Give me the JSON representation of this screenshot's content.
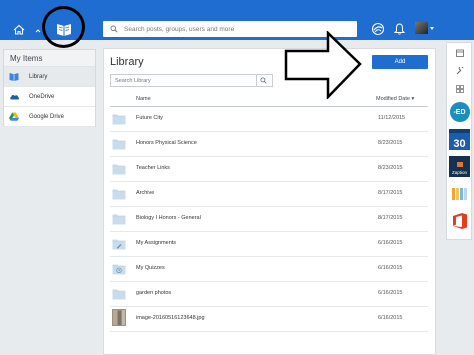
{
  "topbar": {
    "search_placeholder": "Search posts, groups, users and more"
  },
  "sidebar": {
    "title": "My Items",
    "items": [
      {
        "label": "Library",
        "icon": "library-icon"
      },
      {
        "label": "OneDrive",
        "icon": "onedrive-icon"
      },
      {
        "label": "Google Drive",
        "icon": "google-drive-icon"
      }
    ]
  },
  "main": {
    "title": "Library",
    "search_placeholder": "Search Library",
    "add_label": "Add",
    "col_name": "Name",
    "col_modified": "Modified Date",
    "rows": [
      {
        "name": "Future City",
        "date": "11/12/2015",
        "icon": "folder-icon"
      },
      {
        "name": "Honors Physical Science",
        "date": "8/23/2015",
        "icon": "folder-icon"
      },
      {
        "name": "Teacher Links",
        "date": "8/23/2015",
        "icon": "folder-icon"
      },
      {
        "name": "Archive",
        "date": "8/17/2015",
        "icon": "folder-icon"
      },
      {
        "name": "Biology I Honors - General",
        "date": "8/17/2015",
        "icon": "folder-icon"
      },
      {
        "name": "My Assignments",
        "date": "6/16/2015",
        "icon": "assignments-folder-icon"
      },
      {
        "name": "My Quizzes",
        "date": "6/16/2015",
        "icon": "quizzes-folder-icon"
      },
      {
        "name": "garden photos",
        "date": "6/16/2015",
        "icon": "folder-icon"
      },
      {
        "name": "image-20160516123648.jpg",
        "date": "6/16/2015",
        "icon": "image-thumbnail"
      }
    ]
  },
  "rail": {
    "app_ed": "-ED",
    "app_cal": "30",
    "app_zaption": "Zaption"
  },
  "colors": {
    "brand_blue": "#1f6dd1",
    "folder_blue": "#c9dcec"
  }
}
